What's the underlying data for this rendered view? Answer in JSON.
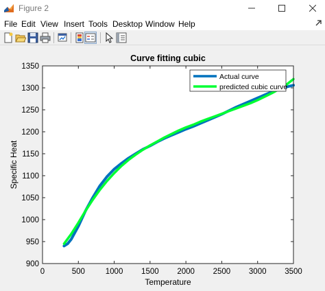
{
  "window": {
    "title": "Figure 2",
    "icon": "matlab-figure-icon",
    "controls": [
      "minimize-icon",
      "maximize-icon",
      "close-icon"
    ]
  },
  "menu": [
    "File",
    "Edit",
    "View",
    "Insert",
    "Tools",
    "Desktop",
    "Window",
    "Help"
  ],
  "toolbar": [
    "new-figure-icon",
    "open-file-icon",
    "save-icon",
    "print-icon",
    "link-plot-icon",
    "colorbar-icon",
    "legend-icon",
    "edit-plot-arrow-icon",
    "property-inspector-icon"
  ],
  "colors": {
    "actual_curve": "#0072bd",
    "predicted_curve": "#00ff33",
    "plot_background": "#ffffff",
    "figure_background": "#f0f0f0"
  },
  "chart_data": {
    "type": "line",
    "title": "Curve fitting cubic",
    "xlabel": "Temperature",
    "ylabel": "Specific Heat",
    "xlim": [
      0,
      3500
    ],
    "ylim": [
      900,
      1350
    ],
    "xticks": [
      "0",
      "500",
      "1000",
      "1500",
      "2000",
      "2500",
      "3000",
      "3500"
    ],
    "yticks": [
      "900",
      "950",
      "1000",
      "1050",
      "1100",
      "1150",
      "1200",
      "1250",
      "1300",
      "1350"
    ],
    "grid": false,
    "legend_position": "top-right",
    "series": [
      {
        "name": "Actual curve",
        "color": "#0072bd",
        "x": [
          300,
          350,
          400,
          500,
          600,
          700,
          800,
          900,
          1000,
          1100,
          1200,
          1300,
          1400,
          1500,
          1600,
          1700,
          1800,
          1900,
          2000,
          2100,
          2200,
          2300,
          2400,
          2500,
          2600,
          2700,
          2800,
          2900,
          3000,
          3100,
          3200,
          3300,
          3400,
          3500
        ],
        "y": [
          940,
          945,
          955,
          985,
          1020,
          1050,
          1077,
          1098,
          1115,
          1128,
          1140,
          1150,
          1160,
          1168,
          1177,
          1185,
          1192,
          1199,
          1206,
          1212,
          1219,
          1226,
          1233,
          1240,
          1248,
          1256,
          1263,
          1270,
          1277,
          1284,
          1291,
          1297,
          1302,
          1306
        ]
      },
      {
        "name": "predicted cubic curve",
        "color": "#00ff33",
        "x": [
          300,
          400,
          500,
          600,
          700,
          800,
          900,
          1000,
          1100,
          1200,
          1300,
          1400,
          1500,
          1600,
          1700,
          1800,
          1900,
          2000,
          2100,
          2200,
          2300,
          2400,
          2500,
          2600,
          2700,
          2800,
          2900,
          3000,
          3100,
          3200,
          3300,
          3400,
          3500
        ],
        "y": [
          945,
          967,
          993,
          1020,
          1045,
          1068,
          1088,
          1106,
          1122,
          1136,
          1148,
          1159,
          1169,
          1178,
          1187,
          1195,
          1203,
          1210,
          1216,
          1223,
          1229,
          1235,
          1241,
          1247,
          1253,
          1259,
          1265,
          1272,
          1280,
          1288,
          1297,
          1307,
          1320
        ]
      }
    ]
  }
}
